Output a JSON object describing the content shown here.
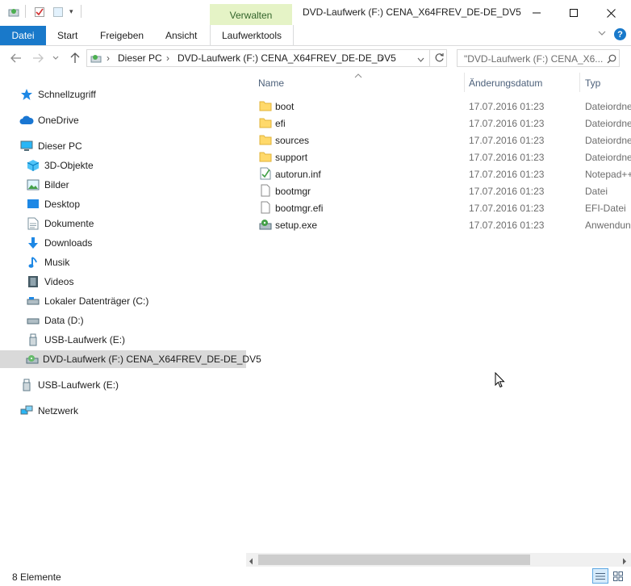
{
  "window": {
    "title": "DVD-Laufwerk (F:) CENA_X64FREV_DE-DE_DV5",
    "context_group_label": "Verwalten",
    "minimize": "—",
    "maximize": "☐",
    "close": "✕"
  },
  "ribbon": {
    "tabs": [
      "Datei",
      "Start",
      "Freigeben",
      "Ansicht",
      "Laufwerktools"
    ],
    "active_tab": "Datei",
    "help": "?"
  },
  "address": {
    "crumbs": [
      "Dieser PC",
      "DVD-Laufwerk (F:) CENA_X64FREV_DE-DE_DV5"
    ],
    "search_placeholder": "\"DVD-Laufwerk (F:) CENA_X6..."
  },
  "nav_pane": {
    "items": [
      {
        "label": "Schnellzugriff",
        "icon": "star-icon",
        "level": 0
      },
      {
        "label": "OneDrive",
        "icon": "cloud-icon",
        "level": 0
      },
      {
        "label": "Dieser PC",
        "icon": "computer-icon",
        "level": 0
      },
      {
        "label": "3D-Objekte",
        "icon": "cube-icon",
        "level": 1
      },
      {
        "label": "Bilder",
        "icon": "pictures-icon",
        "level": 1
      },
      {
        "label": "Desktop",
        "icon": "desktop-icon",
        "level": 1
      },
      {
        "label": "Dokumente",
        "icon": "document-icon",
        "level": 1
      },
      {
        "label": "Downloads",
        "icon": "download-icon",
        "level": 1
      },
      {
        "label": "Musik",
        "icon": "music-icon",
        "level": 1
      },
      {
        "label": "Videos",
        "icon": "video-icon",
        "level": 1
      },
      {
        "label": "Lokaler Datenträger (C:)",
        "icon": "drive-icon",
        "level": 1
      },
      {
        "label": "Data (D:)",
        "icon": "drive-icon",
        "level": 1
      },
      {
        "label": "USB-Laufwerk (E:)",
        "icon": "usb-icon",
        "level": 1
      },
      {
        "label": "DVD-Laufwerk (F:) CENA_X64FREV_DE-DE_DV5",
        "icon": "dvd-icon",
        "level": 1,
        "selected": true
      },
      {
        "label": "USB-Laufwerk (E:)",
        "icon": "usb-icon",
        "level": 0
      },
      {
        "label": "Netzwerk",
        "icon": "network-icon",
        "level": 0
      }
    ]
  },
  "file_list": {
    "columns": [
      "Name",
      "Änderungsdatum",
      "Typ"
    ],
    "rows": [
      {
        "name": "boot",
        "date": "17.07.2016 01:23",
        "type": "Dateiordner",
        "icon": "folder-icon"
      },
      {
        "name": "efi",
        "date": "17.07.2016 01:23",
        "type": "Dateiordner",
        "icon": "folder-icon"
      },
      {
        "name": "sources",
        "date": "17.07.2016 01:23",
        "type": "Dateiordner",
        "icon": "folder-icon"
      },
      {
        "name": "support",
        "date": "17.07.2016 01:23",
        "type": "Dateiordner",
        "icon": "folder-icon"
      },
      {
        "name": "autorun.inf",
        "date": "17.07.2016 01:23",
        "type": "Notepad++",
        "icon": "inf-file-icon"
      },
      {
        "name": "bootmgr",
        "date": "17.07.2016 01:23",
        "type": "Datei",
        "icon": "file-icon"
      },
      {
        "name": "bootmgr.efi",
        "date": "17.07.2016 01:23",
        "type": "EFI-Datei",
        "icon": "file-icon"
      },
      {
        "name": "setup.exe",
        "date": "17.07.2016 01:23",
        "type": "Anwendung",
        "icon": "setup-icon"
      }
    ]
  },
  "status": {
    "item_count": "8 Elemente"
  },
  "colors": {
    "accent": "#1979ca",
    "context_tab_bg": "#e5f3c6",
    "selection_gray": "#d9d9d9",
    "folder": "#ffd96b"
  }
}
